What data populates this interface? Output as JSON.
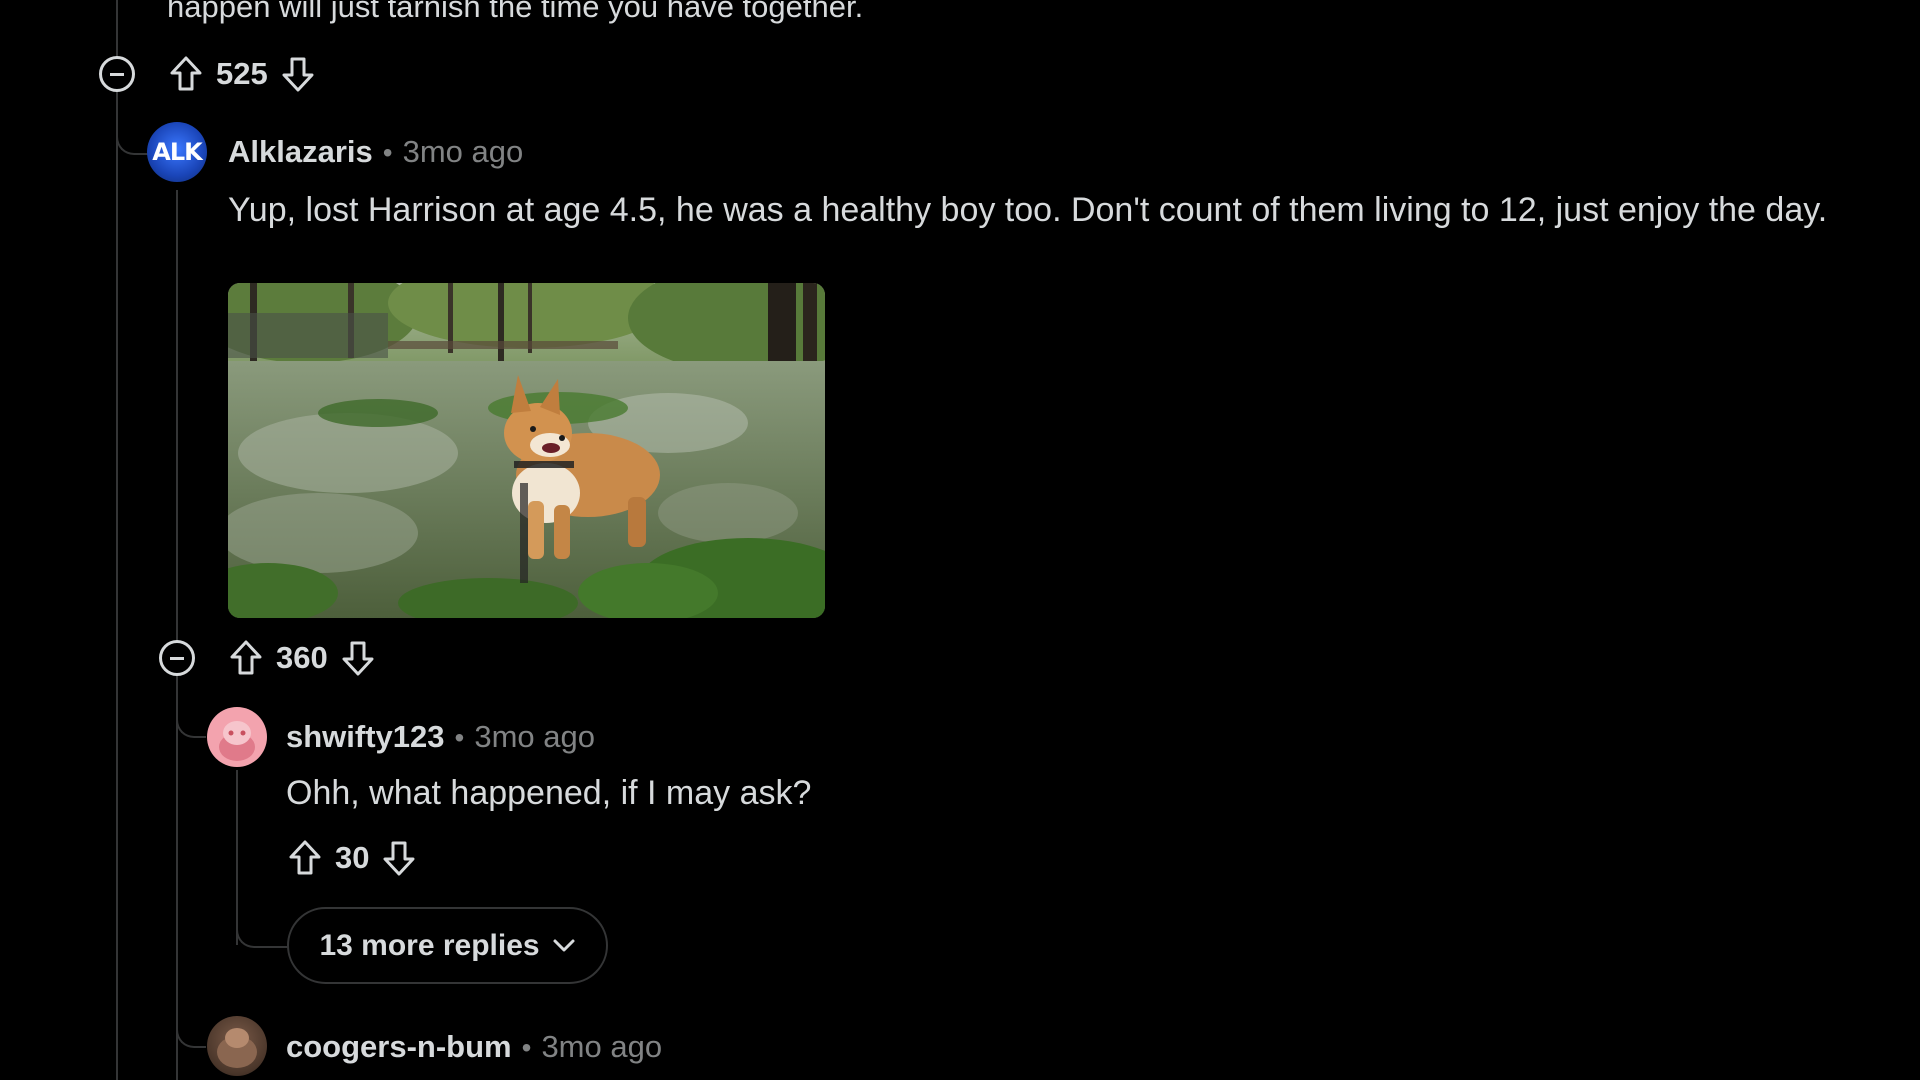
{
  "previous_comment": {
    "text_tail": "happen will just tarnish the time you have together.",
    "score": "525"
  },
  "comments": [
    {
      "username": "Alklazaris",
      "avatar_text": "ALK",
      "separator": "•",
      "time": "3mo ago",
      "body": "Yup, lost Harrison at age 4.5, he was a healthy boy too. Don't count of them living to 12, just enjoy the day.",
      "score": "360"
    },
    {
      "username": "shwifty123",
      "separator": "•",
      "time": "3mo ago",
      "body": "Ohh, what happened, if I may ask?",
      "score": "30",
      "more_replies_label": "13 more replies"
    },
    {
      "username": "coogers-n-bum",
      "separator": "•",
      "time": "3mo ago"
    }
  ],
  "icons": {
    "upvote": "arrow-up-outline-icon",
    "downvote": "arrow-down-outline-icon",
    "collapse": "minus-circle-icon",
    "expand": "chevron-down-icon"
  },
  "colors": {
    "background": "#000000",
    "text": "#d7dadc",
    "muted": "#818384",
    "thread_line": "#343536"
  }
}
